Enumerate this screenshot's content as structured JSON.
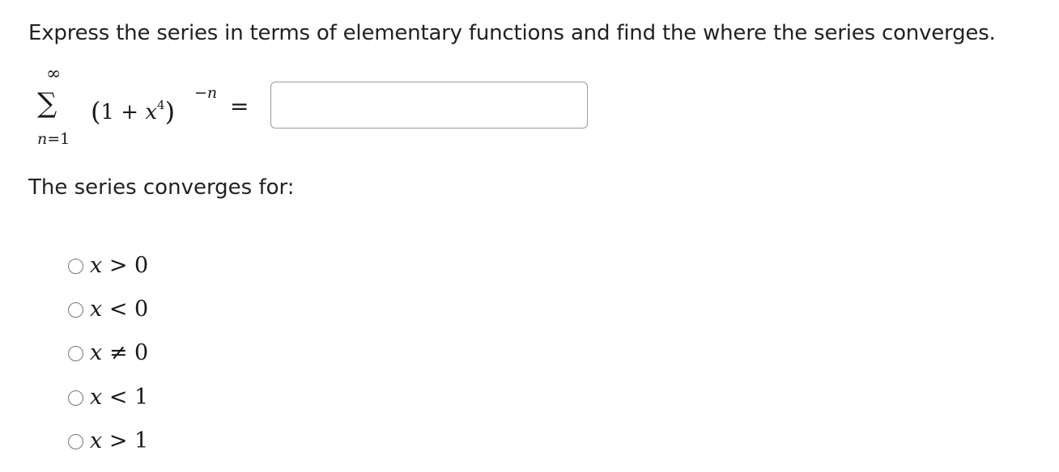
{
  "question": {
    "prompt": "Express the series in terms of elementary functions and find the where the series converges."
  },
  "series": {
    "sigma_symbol": "∑",
    "upper_limit": "∞",
    "lower_limit_var": "n",
    "lower_limit_eq": "=",
    "lower_limit_value": "1",
    "open_paren": "(",
    "constant": "1",
    "plus": " + ",
    "variable": "x",
    "power": "4",
    "close_paren": ")",
    "exponent_minus": "−",
    "exponent_var": "n",
    "equals": "="
  },
  "answer": {
    "value": "",
    "placeholder": ""
  },
  "convergence": {
    "label": "The series converges for:",
    "options": [
      {
        "var": "x",
        "relation": " > ",
        "value": "0",
        "selected": false
      },
      {
        "var": "x",
        "relation": " < ",
        "value": "0",
        "selected": false
      },
      {
        "var": "x",
        "relation": " ≠ ",
        "value": "0",
        "selected": false
      },
      {
        "var": "x",
        "relation": " < ",
        "value": "1",
        "selected": false
      },
      {
        "var": "x",
        "relation": " > ",
        "value": "1",
        "selected": false
      }
    ]
  }
}
